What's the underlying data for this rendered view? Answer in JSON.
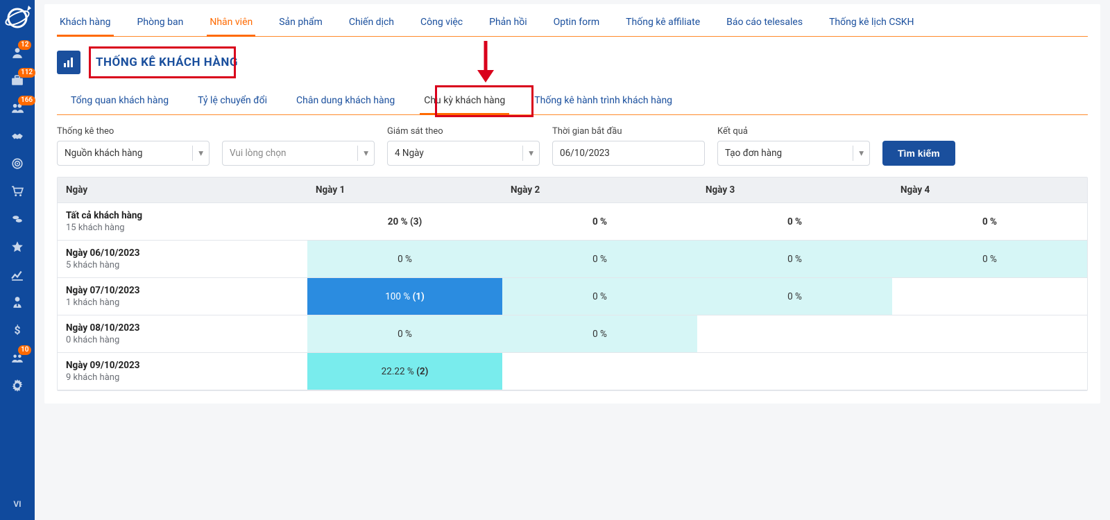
{
  "sidebar": {
    "language": "VI",
    "items": [
      {
        "name": "user-icon",
        "badge": "12"
      },
      {
        "name": "briefcase-icon",
        "badge": "112"
      },
      {
        "name": "users-cog-icon",
        "badge": "166"
      },
      {
        "name": "handshake-icon"
      },
      {
        "name": "target-icon"
      },
      {
        "name": "cart-icon"
      },
      {
        "name": "coins-icon"
      },
      {
        "name": "star-icon"
      },
      {
        "name": "chart-line-icon"
      },
      {
        "name": "user-tie-icon"
      },
      {
        "name": "dollar-icon"
      },
      {
        "name": "group-badge-icon",
        "badge": "10"
      },
      {
        "name": "gear-icon"
      }
    ]
  },
  "primaryTabs": [
    {
      "label": "Khách hàng",
      "active": true,
      "name": "tab-customers"
    },
    {
      "label": "Phòng ban",
      "name": "tab-department"
    },
    {
      "label": "Nhân viên",
      "active": true,
      "name": "tab-staff",
      "orange": true
    },
    {
      "label": "Sản phẩm",
      "name": "tab-products"
    },
    {
      "label": "Chiến dịch",
      "name": "tab-campaign"
    },
    {
      "label": "Công việc",
      "name": "tab-work"
    },
    {
      "label": "Phản hồi",
      "name": "tab-feedback"
    },
    {
      "label": "Optin form",
      "name": "tab-optin"
    },
    {
      "label": "Thống kê affiliate",
      "name": "tab-affiliate"
    },
    {
      "label": "Báo cáo telesales",
      "name": "tab-telesales"
    },
    {
      "label": "Thống kê lịch CSKH",
      "name": "tab-cskh"
    }
  ],
  "heading": "THỐNG KÊ KHÁCH HÀNG",
  "secondaryTabs": [
    {
      "label": "Tổng quan khách hàng",
      "name": "subtab-overview"
    },
    {
      "label": "Tỷ lệ chuyển đổi",
      "name": "subtab-conversion"
    },
    {
      "label": "Chân dung khách hàng",
      "name": "subtab-profile"
    },
    {
      "label": "Chu kỳ khách hàng",
      "name": "subtab-cycle",
      "active": true
    },
    {
      "label": "Thống kê hành trình khách hàng",
      "name": "subtab-journey"
    }
  ],
  "filters": {
    "thongKeTheo": {
      "label": "Thống kê theo",
      "value": "Nguồn khách hàng"
    },
    "secondSelect": {
      "placeholder": "Vui lòng chọn"
    },
    "giamSatTheo": {
      "label": "Giám sát theo",
      "value": "4 Ngày"
    },
    "thoiGian": {
      "label": "Thời gian bắt đầu",
      "value": "06/10/2023"
    },
    "ketQua": {
      "label": "Kết quả",
      "value": "Tạo đơn hàng"
    },
    "searchButton": "Tìm kiếm"
  },
  "cohort": {
    "headers": [
      "Ngày",
      "Ngày 1",
      "Ngày 2",
      "Ngày 3",
      "Ngày 4"
    ],
    "rows": [
      {
        "title": "Tất cả khách hàng",
        "sub": "15 khách hàng",
        "cells": [
          {
            "text": "20 % (3)",
            "bold": true
          },
          {
            "text": "0 %",
            "bold": true
          },
          {
            "text": "0 %",
            "bold": true
          },
          {
            "text": "0 %",
            "bold": true
          }
        ]
      },
      {
        "title": "Ngày 06/10/2023",
        "sub": "5 khách hàng",
        "cells": [
          {
            "text": "0 %",
            "tone": "v0"
          },
          {
            "text": "0 %",
            "tone": "v0"
          },
          {
            "text": "0 %",
            "tone": "v0"
          },
          {
            "text": "0 %",
            "tone": "v0"
          }
        ]
      },
      {
        "title": "Ngày 07/10/2023",
        "sub": "1 khách hàng",
        "cells": [
          {
            "text": "100 % ",
            "count": "(1)",
            "tone": "v2"
          },
          {
            "text": "0 %",
            "tone": "v0"
          },
          {
            "text": "0 %",
            "tone": "v0"
          },
          {
            "empty": true
          }
        ]
      },
      {
        "title": "Ngày 08/10/2023",
        "sub": "0 khách hàng",
        "cells": [
          {
            "text": "0 %",
            "tone": "v0"
          },
          {
            "text": "0 %",
            "tone": "v0"
          },
          {
            "empty": true
          },
          {
            "empty": true
          }
        ]
      },
      {
        "title": "Ngày 09/10/2023",
        "sub": "9 khách hàng",
        "cells": [
          {
            "text": "22.22 % ",
            "count": "(2)",
            "tone": "v1"
          },
          {
            "empty": true
          },
          {
            "empty": true
          },
          {
            "empty": true
          }
        ]
      }
    ]
  }
}
